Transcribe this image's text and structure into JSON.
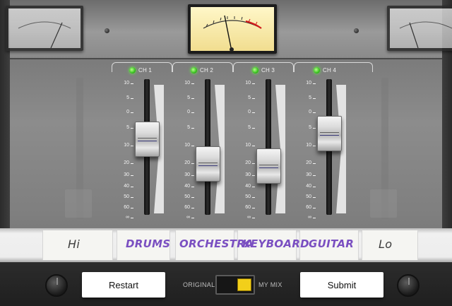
{
  "channels": [
    {
      "id": "ch1",
      "label": "CH 1",
      "level": 0.57,
      "name": "DRUMS"
    },
    {
      "id": "ch2",
      "label": "CH 2",
      "level": 0.33,
      "name": "ORCHESTRA"
    },
    {
      "id": "ch3",
      "label": "CH 3",
      "level": 0.31,
      "name": "KEYBOARD"
    },
    {
      "id": "ch4",
      "label": "CH 4",
      "level": 0.62,
      "name": "GUITAR"
    }
  ],
  "scale_ticks": [
    "10",
    "5",
    "0",
    "5",
    "10",
    "20",
    "30",
    "40",
    "50",
    "60",
    "∞"
  ],
  "tape": {
    "left": "Hi",
    "right": "Lo"
  },
  "buttons": {
    "restart": "Restart",
    "submit": "Submit"
  },
  "mix_switch": {
    "left_label": "ORIGINAL",
    "right_label": "MY MIX",
    "selected": "MY MIX"
  },
  "colors": {
    "led": "#37c21e",
    "tape_ink": "#7a4fc1",
    "switch": "#f2cf1a",
    "meter_red": "#d21b1b"
  },
  "icons": [
    "vu-meter-icon",
    "led-icon",
    "knob-icon",
    "screw-icon"
  ]
}
